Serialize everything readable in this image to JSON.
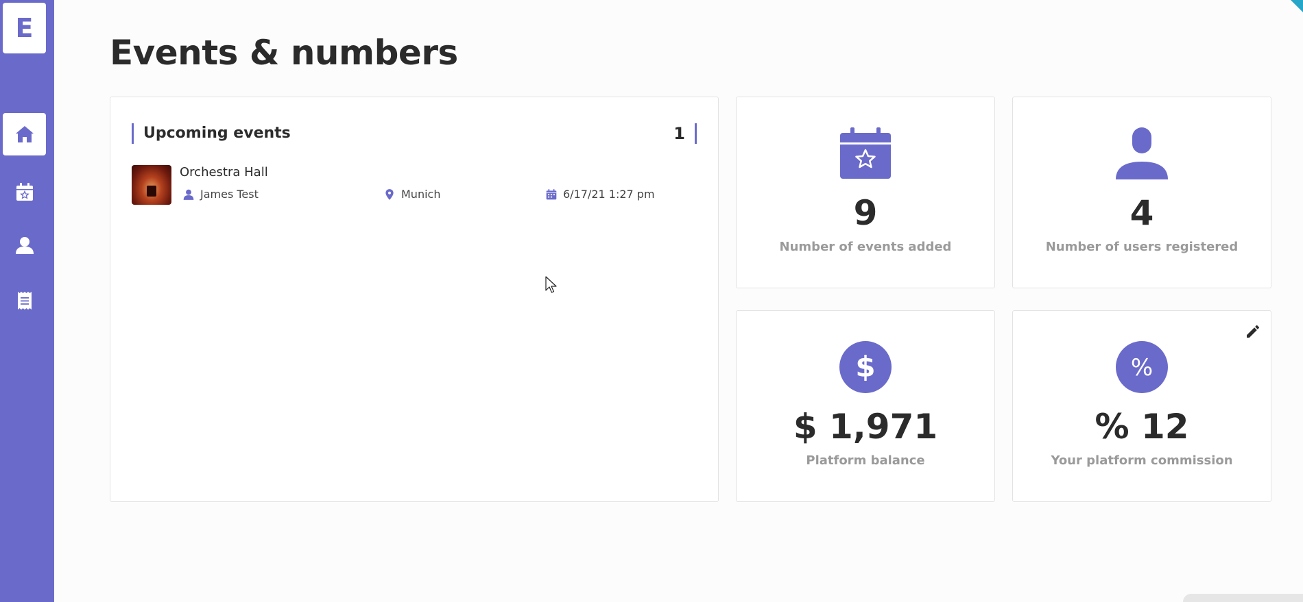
{
  "app": {
    "logo_letter": "E"
  },
  "sidebar": {
    "items": [
      {
        "name": "home",
        "icon": "home-icon",
        "active": true
      },
      {
        "name": "events",
        "icon": "calendar-star-icon",
        "active": false
      },
      {
        "name": "users",
        "icon": "user-icon",
        "active": false
      },
      {
        "name": "receipts",
        "icon": "receipt-icon",
        "active": false
      }
    ]
  },
  "page": {
    "title": "Events & numbers"
  },
  "upcoming": {
    "title": "Upcoming events",
    "count": "1",
    "events": [
      {
        "name": "Orchestra Hall",
        "organizer": "James Test",
        "location": "Munich",
        "datetime": "6/17/21 1:27 pm"
      }
    ]
  },
  "stats": {
    "events_added": {
      "value": "9",
      "label": "Number of events added",
      "icon": "calendar-star-icon"
    },
    "users_registered": {
      "value": "4",
      "label": "Number of users registered",
      "icon": "user-icon"
    },
    "platform_balance": {
      "value": "$ 1,971",
      "label": "Platform balance",
      "icon": "dollar-icon"
    },
    "platform_commission": {
      "value": "% 12",
      "label": "Your platform commission",
      "icon": "percent-icon"
    }
  },
  "colors": {
    "accent": "#6a6acb",
    "sidebar": "#6a6acb",
    "label_gray": "#9a9a9a"
  }
}
